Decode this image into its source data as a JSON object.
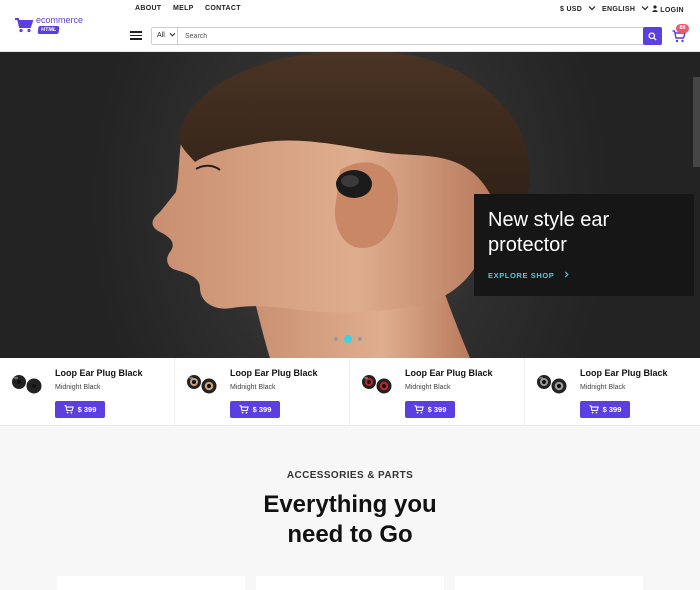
{
  "brand": {
    "name": "ecommerce",
    "badge": "HTML"
  },
  "topnav": {
    "about": "ABOUT",
    "help": "MELP",
    "contact": "CONTACT",
    "currency": "$ USD",
    "language": "ENGLISH",
    "login": "LOGIN"
  },
  "search": {
    "category": "All",
    "placeholder": "Search"
  },
  "cart": {
    "count": "88"
  },
  "hero": {
    "title": "New style ear protector",
    "cta": "EXPLORE SHOP",
    "slides": 3,
    "active_slide": 2
  },
  "products": [
    {
      "name": "Loop Ear Plug Black",
      "variant": "Midnight Black",
      "price": "$ 399",
      "accent": "#222222"
    },
    {
      "name": "Loop Ear Plug Black",
      "variant": "Midnight Black",
      "price": "$ 399",
      "accent": "#c9a27a"
    },
    {
      "name": "Loop Ear Plug Black",
      "variant": "Midnight Black",
      "price": "$ 399",
      "accent": "#c0242e"
    },
    {
      "name": "Loop Ear Plug Black",
      "variant": "Midnight Black",
      "price": "$ 399",
      "accent": "#9a9a9a"
    }
  ],
  "section": {
    "eyebrow": "ACCESSORIES & PARTS",
    "title_line1": "Everything you",
    "title_line2": "need to Go"
  },
  "colors": {
    "accent": "#5b3fe0",
    "highlight": "#3fd0e6",
    "badge": "#f0566b"
  }
}
